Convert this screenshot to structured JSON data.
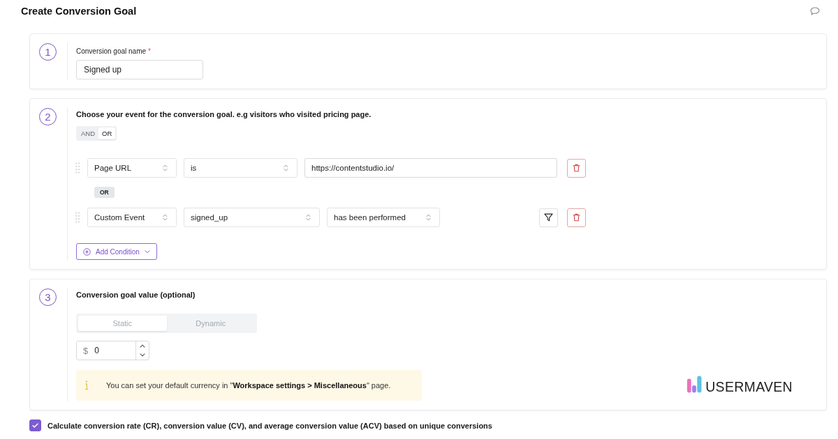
{
  "title": "Create Conversion Goal",
  "name_step": {
    "number": "1",
    "label": "Conversion goal name",
    "required_mark": "*",
    "value": "Signed up"
  },
  "event_step": {
    "number": "2",
    "heading": "Choose your event for the conversion goal. e.g visitors who visited pricing page.",
    "operators": [
      {
        "label": "AND",
        "selected": false
      },
      {
        "label": "OR",
        "selected": true
      }
    ],
    "conditions": [
      {
        "fields": [
          {
            "kind": "select",
            "value": "Page URL"
          },
          {
            "kind": "select",
            "value": "is"
          },
          {
            "kind": "text",
            "value": "https://contentstudio.io/"
          }
        ],
        "actions": [
          {
            "kind": "delete"
          }
        ]
      },
      {
        "joiner": "OR",
        "fields": [
          {
            "kind": "select",
            "value": "Custom Event"
          },
          {
            "kind": "select",
            "value": "signed_up"
          },
          {
            "kind": "select",
            "value": "has been performed"
          }
        ],
        "actions": [
          {
            "kind": "filter"
          },
          {
            "kind": "delete"
          }
        ]
      }
    ],
    "add_button": "Add Condition"
  },
  "value_step": {
    "number": "3",
    "heading": "Conversion goal value (optional)",
    "modes": [
      {
        "label": "Static",
        "selected": true
      },
      {
        "label": "Dynamic",
        "selected": false
      }
    ],
    "currency": "$",
    "amount": "0",
    "note": "You can set your default currency in \"**Workspace settings > Miscellaneous**\" page."
  },
  "brand": {
    "name": "USERMAVEN"
  },
  "unique_option": {
    "label": "Calculate conversion rate (CR), conversion value (CV), and average conversion value (ACV) based on unique conversions",
    "checked": true
  }
}
